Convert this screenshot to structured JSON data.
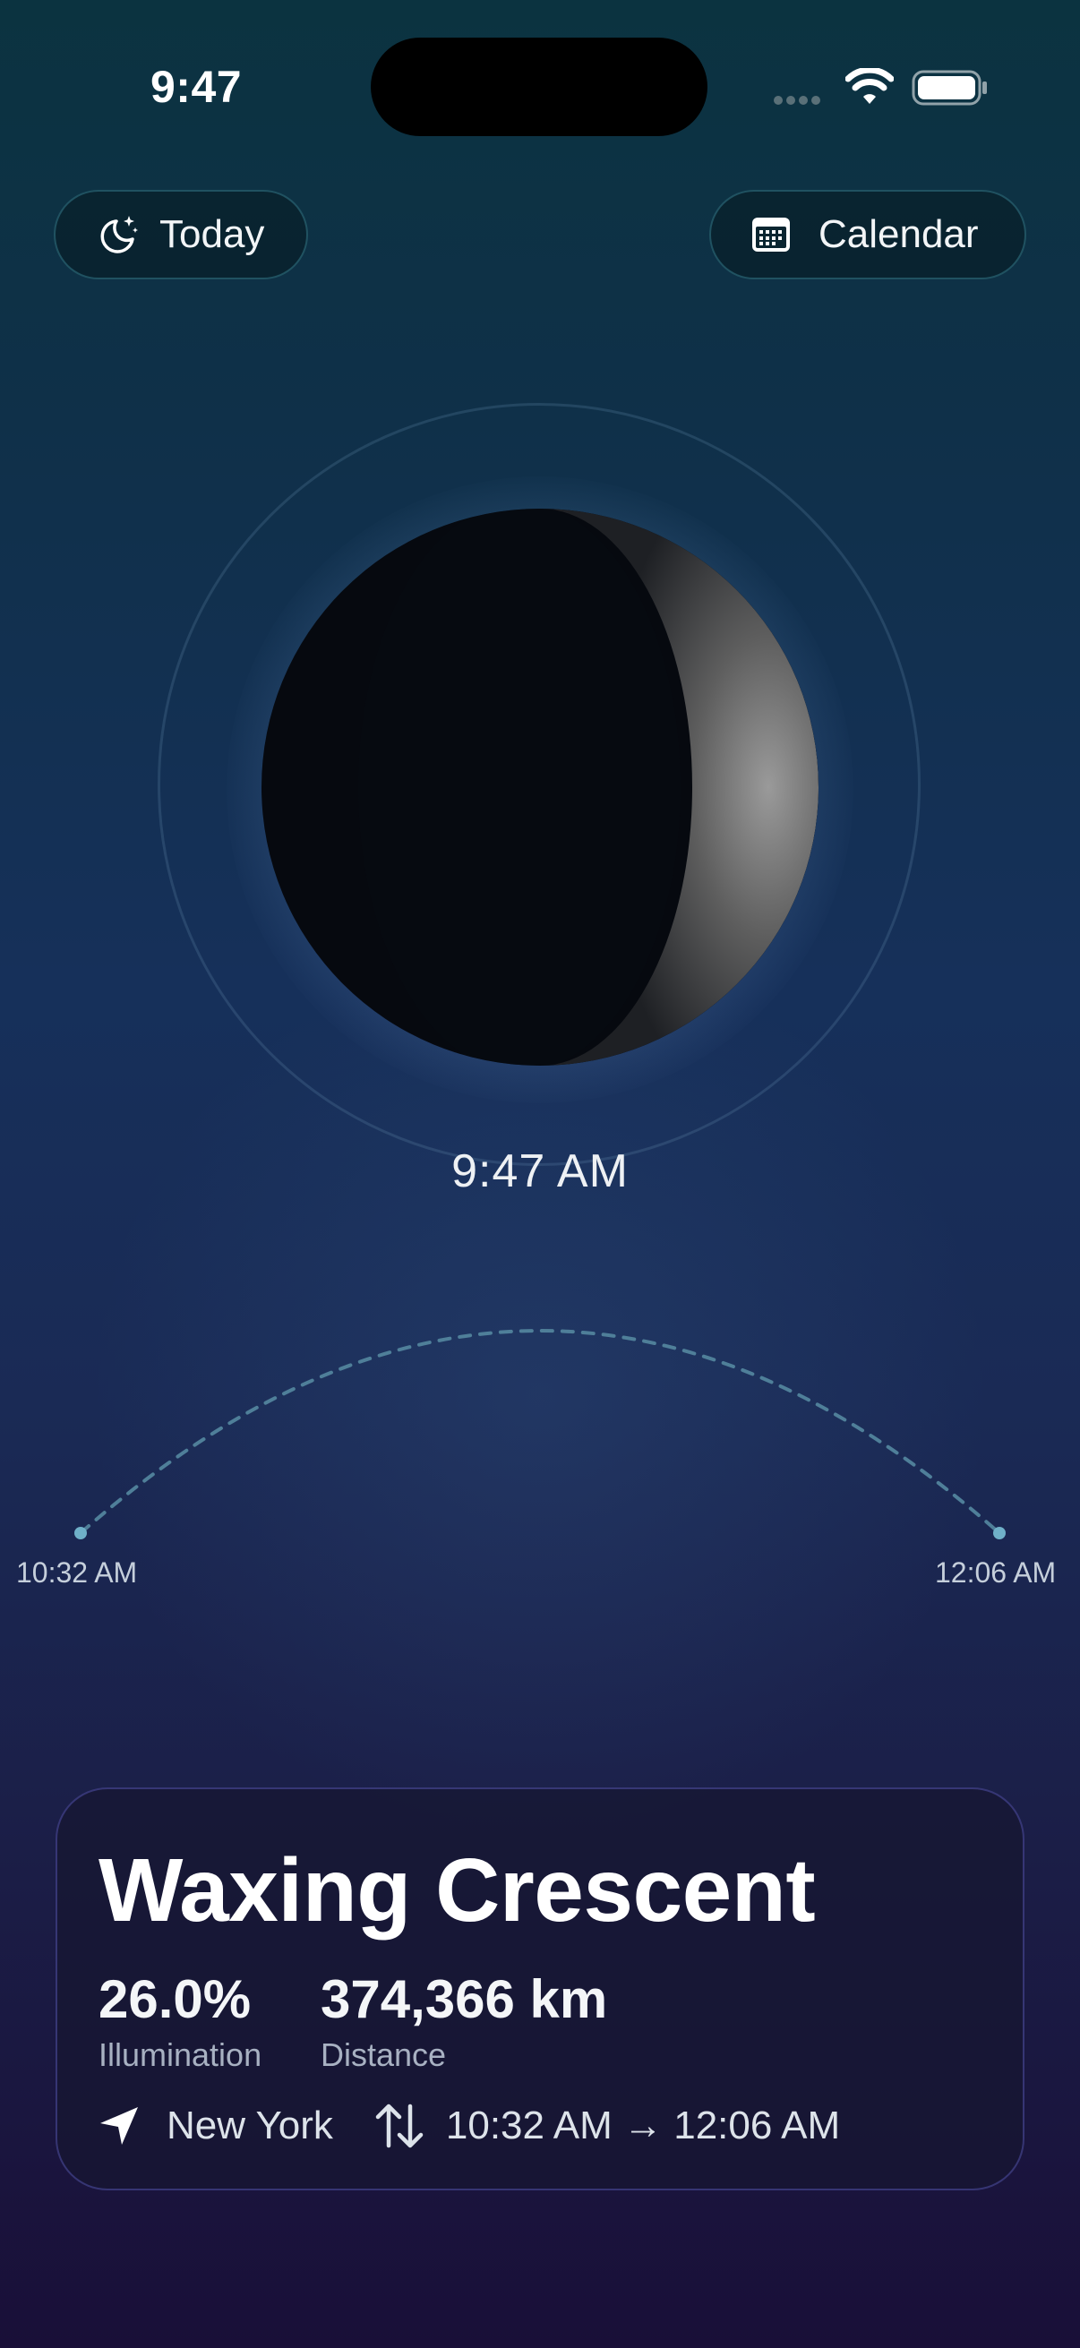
{
  "status_bar": {
    "time": "9:47"
  },
  "toolbar": {
    "today_label": "Today",
    "calendar_label": "Calendar"
  },
  "moon_view": {
    "current_time": "9:47 AM",
    "moonrise_time": "10:32 AM",
    "moonset_time": "12:06 AM"
  },
  "info_card": {
    "phase_name": "Waxing Crescent",
    "illumination_value": "26.0%",
    "illumination_label": "Illumination",
    "distance_value": "374,366 km",
    "distance_label": "Distance",
    "location": "New York",
    "rise_set_range": "10:32 AM → 12:06 AM"
  },
  "colors": {
    "accent_dot": "#6fb0c8",
    "card_border": "#50509a",
    "pill_border": "#3c8ca0"
  },
  "icons": [
    "moon-stars-icon",
    "calendar-icon",
    "location-arrow-icon",
    "arrows-up-down-icon",
    "wifi-icon",
    "battery-icon",
    "signal-icon"
  ]
}
